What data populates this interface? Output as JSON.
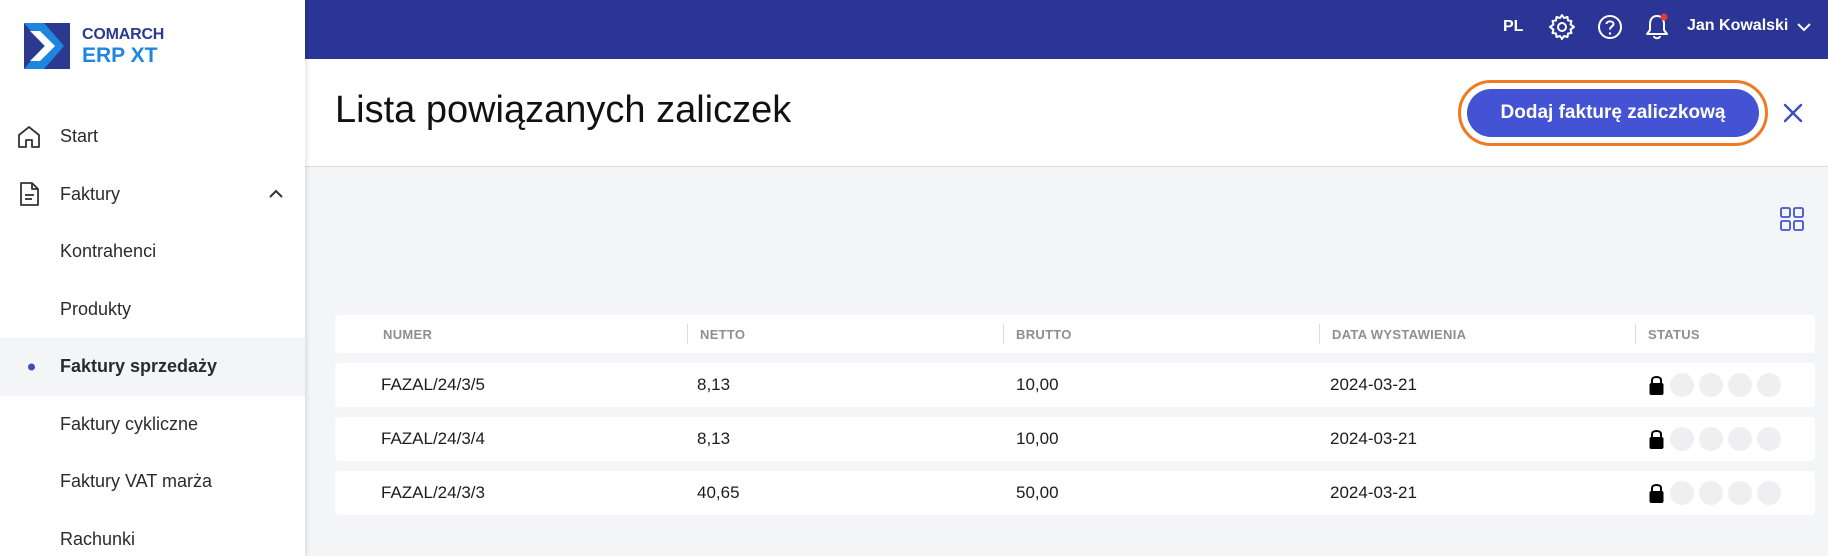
{
  "app": {
    "logo_line1": "COMARCH",
    "logo_line2": "ERP XT"
  },
  "sidebar": {
    "items": [
      {
        "label": "Start",
        "icon": "home-icon"
      },
      {
        "label": "Faktury",
        "icon": "document-icon",
        "expanded": true
      },
      {
        "label": "Kontrahenci"
      },
      {
        "label": "Produkty"
      },
      {
        "label": "Faktury sprzedaży",
        "active": true
      },
      {
        "label": "Faktury cykliczne"
      },
      {
        "label": "Faktury VAT marża"
      },
      {
        "label": "Rachunki"
      }
    ]
  },
  "topbar": {
    "lang": "PL",
    "user_name": "Jan Kowalski",
    "icons": [
      "gear-icon",
      "help-icon",
      "bell-icon"
    ],
    "notification_dot_color": "#e53935"
  },
  "header": {
    "title": "Lista powiązanych zaliczek",
    "primary_button": "Dodaj fakturę zaliczkową"
  },
  "table": {
    "columns": [
      "NUMER",
      "NETTO",
      "BRUTTO",
      "DATA WYSTAWIENIA",
      "STATUS"
    ],
    "rows": [
      {
        "numer": "FAZAL/24/3/5",
        "netto": "8,13",
        "brutto": "10,00",
        "data": "2024-03-21",
        "status": "locked"
      },
      {
        "numer": "FAZAL/24/3/4",
        "netto": "8,13",
        "brutto": "10,00",
        "data": "2024-03-21",
        "status": "locked"
      },
      {
        "numer": "FAZAL/24/3/3",
        "netto": "40,65",
        "brutto": "50,00",
        "data": "2024-03-21",
        "status": "locked"
      }
    ]
  },
  "colors": {
    "topbar": "#2a3596",
    "accent": "#4453d3",
    "highlight_outline": "#f07a24"
  }
}
